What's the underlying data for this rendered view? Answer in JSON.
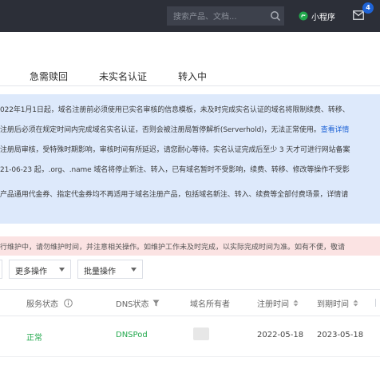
{
  "header": {
    "search_placeholder": "搜索产品、文档...",
    "mini_program_label": "小程序",
    "mail_badge_count": "4"
  },
  "tabs": [
    {
      "label": "急需赎回"
    },
    {
      "label": "未实名认证"
    },
    {
      "label": "转入中"
    }
  ],
  "notice": {
    "lines": [
      "022年1月1日起，域名注册前必须使用已实名审核的信息模板，未及时完成实名认证的域名将限制续费、转移、",
      "注册后必须在规定时间内完成域名实名认证，否则会被注册局暂停解析(Serverhold)，无法正常使用。",
      "注册局审核，受特殊时期影响，审核时间有所延迟，请您耐心等待。实名认证完成后至少 3 天才可进行网站备案",
      "21-06-23 起，.org、.name 域名将停止新注、转入，已有域名暂时不受影响，续费、转移、修改等操作不受影",
      "产品通用代金券、指定代金券均不再适用于域名注册产品，包括域名新注、转入、续费等全部付费场景，详情请"
    ],
    "link_text": "查看详情"
  },
  "warning": {
    "text": "行维护中，请勿维护时间，并注意相关操作。如维护工作未及时完成，以实际完成时间为准。如有不便，敬请"
  },
  "toolbar": {
    "more_actions_label": "更多操作",
    "batch_actions_label": "批量操作"
  },
  "table": {
    "headers": {
      "status": "服务状态",
      "dns_status": "DNS状态",
      "owner": "域名所有者",
      "reg_time": "注册时间",
      "expire_time": "到期时间"
    },
    "rows": [
      {
        "status": "正常",
        "dns_status": "DNSPod",
        "reg_time": "2022-05-18",
        "expire_time": "2023-05-18"
      }
    ]
  },
  "colors": {
    "topbar": "#2c2f38",
    "info_bg": "#dde9fb",
    "warn_bg": "#fbe3e3",
    "accent": "#1e63d6",
    "status_green": "#21a84c"
  }
}
